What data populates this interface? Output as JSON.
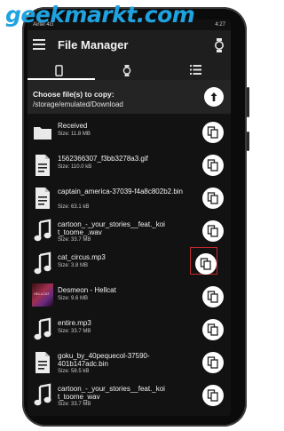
{
  "watermark": "geekmarkt.com",
  "status": {
    "left": "Airtel 4G",
    "time": "4:27"
  },
  "app": {
    "title": "File Manager"
  },
  "tabs": [
    {
      "icon": "phone-icon",
      "active": true
    },
    {
      "icon": "watch-icon",
      "active": false
    },
    {
      "icon": "list-icon",
      "active": false
    }
  ],
  "path": {
    "label": "Choose file(s) to copy:",
    "value": "/storage/emulated/Download"
  },
  "files": [
    {
      "name": "Received",
      "size": "Size: 11.8 MB",
      "type": "folder"
    },
    {
      "name": "1562366307_f3bb3278a3.gif",
      "size": "Size: 110.0 kB",
      "type": "document"
    },
    {
      "name": "captain_america-37039-f4a8c802b2.bin",
      "size": "Size: 63.1 kB",
      "type": "document"
    },
    {
      "name": "cartoon_-_your_stories__feat._koi t_toome_.wav",
      "size": "Size: 33.7 MB",
      "type": "music"
    },
    {
      "name": "cat_circus.mp3",
      "size": "Size: 3.8 MB",
      "type": "music",
      "highlighted": true
    },
    {
      "name": "Desmeon  - Hellcat",
      "size": "Size: 9.6 MB",
      "type": "album"
    },
    {
      "name": "entire.mp3",
      "size": "Size: 33.7 MB",
      "type": "music"
    },
    {
      "name": "goku_by_40pequecol-37590-401b147adc.bin",
      "size": "Size: 58.5 kB",
      "type": "document"
    },
    {
      "name": "cartoon_-_your_stories__feat._koi t_toome_wav",
      "size": "Size: 33.7 MB",
      "type": "music"
    }
  ]
}
